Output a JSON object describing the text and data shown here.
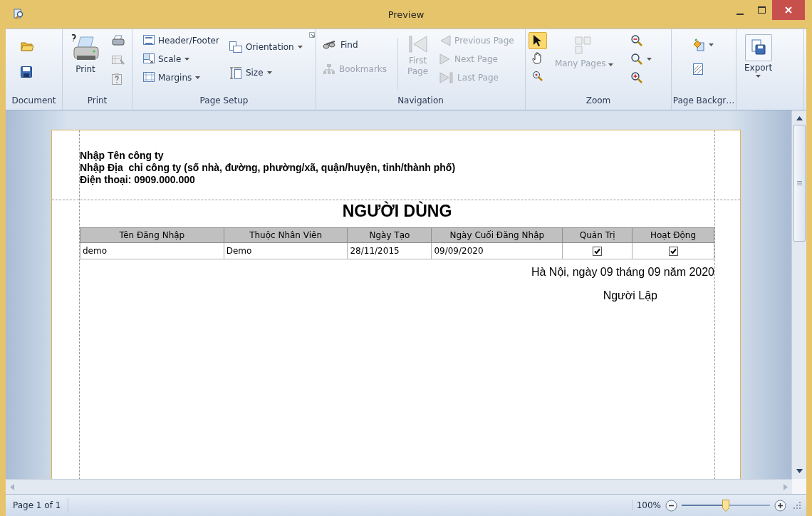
{
  "window": {
    "title": "Preview"
  },
  "ribbon": {
    "groups": [
      {
        "label": "Document",
        "buttons": [
          {
            "disabled": false
          },
          {
            "disabled": false
          }
        ]
      },
      {
        "label": "Print",
        "buttons": [
          {
            "label": "Print",
            "disabled": false
          },
          {
            "disabled": false
          },
          {
            "disabled": true
          },
          {
            "disabled": true
          }
        ]
      },
      {
        "label": "Page Setup",
        "buttons": [
          {
            "label": "Header/Footer",
            "dropdown": false,
            "disabled": false
          },
          {
            "label": "Scale",
            "dropdown": true,
            "disabled": false
          },
          {
            "label": "Margins",
            "dropdown": true,
            "disabled": false
          },
          {
            "label": "Orientation",
            "dropdown": true,
            "disabled": false
          },
          {
            "label": "Size",
            "dropdown": true,
            "disabled": false
          }
        ]
      },
      {
        "label": "Navigation",
        "buttons": [
          {
            "label": "Find",
            "disabled": false
          },
          {
            "label": "Bookmarks",
            "disabled": true
          },
          {
            "label": "First Page",
            "disabled": true
          },
          {
            "label": "Previous Page",
            "disabled": true
          },
          {
            "label": "Next Page",
            "disabled": true
          },
          {
            "label": "Last Page",
            "disabled": true
          }
        ]
      },
      {
        "label": "Zoom",
        "buttons": [
          {
            "selected": true
          },
          {
            "selected": false
          },
          {
            "selected": false
          },
          {
            "label": "Many Pages",
            "dropdown": true,
            "disabled": true
          },
          {
            "disabled": false
          },
          {
            "dropdown": true,
            "disabled": false
          },
          {
            "disabled": false
          }
        ]
      },
      {
        "label": "Page Backgr…",
        "buttons": [
          {
            "dropdown": true,
            "disabled": false
          },
          {
            "disabled": false
          }
        ]
      },
      {
        "buttons": [
          {
            "label": "Export",
            "dropdown": true,
            "disabled": false
          }
        ]
      }
    ]
  },
  "report": {
    "company_lines": [
      "Nhập Tên công ty",
      "Nhập Địa  chỉ công ty (số nhà, đường, phường/xã, quận/huyện, tỉnh/thành phố)",
      "Điện thoại: 0909.000.000"
    ],
    "title": "NGƯỜI DÙNG",
    "columns": [
      "Tên Đăng Nhập",
      "Thuộc Nhân Viên",
      "Ngày Tạo",
      "Ngày Cuối Đăng Nhập",
      "Quản Trị",
      "Hoạt Động"
    ],
    "rows": [
      {
        "login": "demo",
        "employee": "Demo",
        "created": "28/11/2015",
        "last_login": "09/09/2020",
        "admin": true,
        "active": true
      }
    ],
    "date_line": "Hà Nội, ngày 09 tháng 09 năm 2020",
    "signer": "Người Lập"
  },
  "status_bar": {
    "page": "Page 1 of 1",
    "zoom": "100%",
    "zoom_slider": {
      "level": 0.5
    }
  }
}
